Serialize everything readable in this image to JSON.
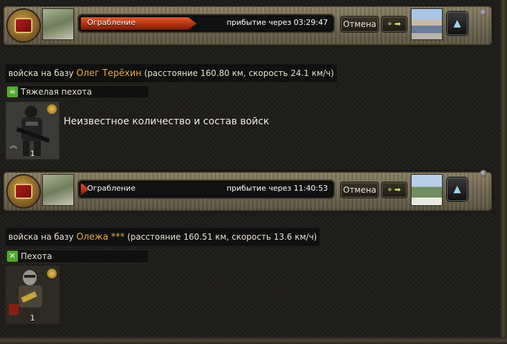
{
  "colors": {
    "progress": "#b23312",
    "nickname": "#e6a94a",
    "heavy_icon": "#4fa82c",
    "infantry_icon": "#4fa82c"
  },
  "attacks": [
    {
      "mission": "Ограбление",
      "arrival": "прибытие через 03:29:47",
      "progress_fraction": 0.46,
      "cancel_label": "Отмена",
      "locate_icon": "map-pin-arrow-icon",
      "info_prefix": "войска на базу",
      "nickname": "Олег Терёхин",
      "info_suffix": "(расстояние 160.80 км, скорость 24.1 км/ч)",
      "unit_type": "Тяжелая пехота",
      "unit_type_icon": "skull-icon",
      "unit_count": "1",
      "unit_note": "Неизвестное количество и состав войск"
    },
    {
      "mission": "Ограбление",
      "arrival": "прибытие через 11:40:53",
      "progress_fraction": 0.01,
      "cancel_label": "Отмена",
      "locate_icon": "map-pin-arrow-icon",
      "info_prefix": "войска на базу",
      "nickname": "Олежа ***",
      "info_suffix": "(расстояние 160.51 км, скорость 13.6 км/ч)",
      "unit_type": "Пехота",
      "unit_type_icon": "crossed-swords-icon",
      "unit_count": "1",
      "unit_note": ""
    }
  ]
}
